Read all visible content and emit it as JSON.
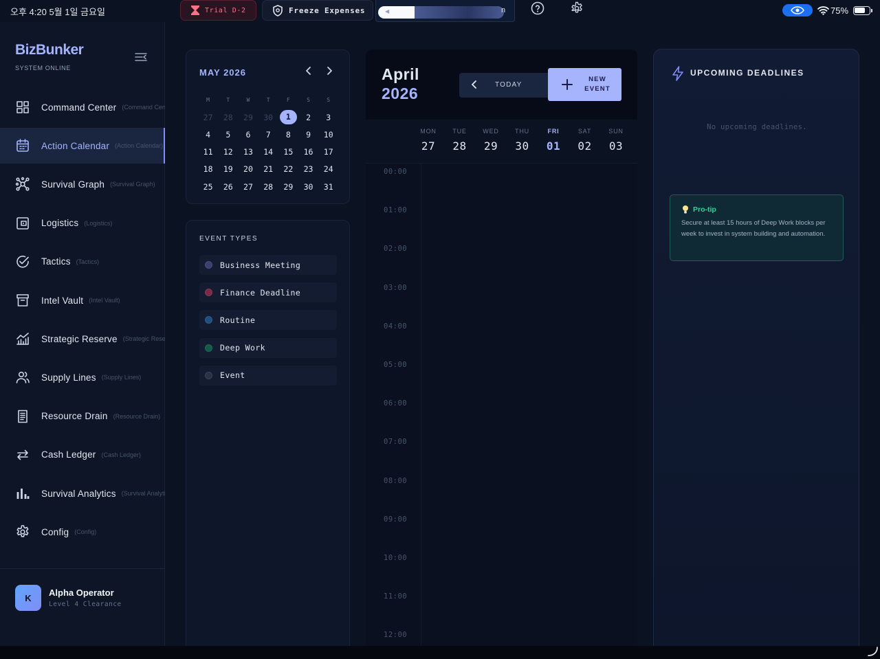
{
  "status_bar": {
    "time": "오후 4:20  5월 1일 금요일",
    "trial_label": "Trial D-2",
    "freeze_label": "Freeze Expenses",
    "url_fragment": "n",
    "battery": "75%"
  },
  "sidebar": {
    "brand": "BizBunker",
    "status": "SYSTEM ONLINE",
    "items": [
      {
        "label": "Command Center",
        "sub": "(Command Center)",
        "icon": "dashboard-icon"
      },
      {
        "label": "Action Calendar",
        "sub": "(Action Calendar)",
        "icon": "calendar-icon",
        "active": true
      },
      {
        "label": "Survival Graph",
        "sub": "(Survival Graph)",
        "icon": "graph-nodes-icon"
      },
      {
        "label": "Logistics",
        "sub": "(Logistics)",
        "icon": "wallet-icon"
      },
      {
        "label": "Tactics",
        "sub": "(Tactics)",
        "icon": "check-circle-icon"
      },
      {
        "label": "Intel Vault",
        "sub": "(Intel Vault)",
        "icon": "archive-icon"
      },
      {
        "label": "Strategic Reserve",
        "sub": "(Strategic Reserve)",
        "icon": "growth-chart-icon"
      },
      {
        "label": "Supply Lines",
        "sub": "(Supply Lines)",
        "icon": "users-icon"
      },
      {
        "label": "Resource Drain",
        "sub": "(Resource Drain)",
        "icon": "receipt-icon"
      },
      {
        "label": "Cash Ledger",
        "sub": "(Cash Ledger)",
        "icon": "transfer-arrows-icon"
      },
      {
        "label": "Survival Analytics",
        "sub": "(Survival Analytics)",
        "icon": "bar-chart-icon"
      },
      {
        "label": "Config",
        "sub": "(Config)",
        "icon": "gear-icon"
      }
    ],
    "user": {
      "initial": "K",
      "name": "Alpha Operator",
      "level": "Level 4 Clearance"
    }
  },
  "mini_calendar": {
    "month": "MAY 2026",
    "weekday_heads": [
      "M",
      "T",
      "W",
      "T",
      "F",
      "S",
      "S"
    ],
    "weeks": [
      [
        "27",
        "28",
        "29",
        "30",
        "1",
        "2",
        "3"
      ],
      [
        "4",
        "5",
        "6",
        "7",
        "8",
        "9",
        "10"
      ],
      [
        "11",
        "12",
        "13",
        "14",
        "15",
        "16",
        "17"
      ],
      [
        "18",
        "19",
        "20",
        "21",
        "22",
        "23",
        "24"
      ],
      [
        "25",
        "26",
        "27",
        "28",
        "29",
        "30",
        "31"
      ]
    ],
    "selected": "1"
  },
  "event_types": {
    "title": "EVENT TYPES",
    "items": [
      {
        "label": "Business Meeting",
        "color": "#3b3f70"
      },
      {
        "label": "Finance Deadline",
        "color": "#7a2a45"
      },
      {
        "label": "Routine",
        "color": "#1f4f80"
      },
      {
        "label": "Deep Work",
        "color": "#125a4a"
      },
      {
        "label": "Event",
        "color": "#2a3244"
      }
    ]
  },
  "main_calendar": {
    "month": "April",
    "year": "2026",
    "today_label": "TODAY",
    "new_event_label": "NEW EVENT",
    "days": [
      {
        "name": "MON",
        "num": "27"
      },
      {
        "name": "TUE",
        "num": "28"
      },
      {
        "name": "WED",
        "num": "29"
      },
      {
        "name": "THU",
        "num": "30"
      },
      {
        "name": "FRI",
        "num": "01",
        "today": true
      },
      {
        "name": "SAT",
        "num": "02"
      },
      {
        "name": "SUN",
        "num": "03"
      }
    ],
    "hours": [
      "00:00",
      "01:00",
      "02:00",
      "03:00",
      "04:00",
      "05:00",
      "06:00",
      "07:00",
      "08:00",
      "09:00",
      "10:00",
      "11:00",
      "12:00"
    ]
  },
  "deadlines": {
    "title": "UPCOMING DEADLINES",
    "empty": "No upcoming deadlines.",
    "tip_title": "Pro-tip",
    "tip_text": "Secure at least 15 hours of Deep Work blocks per week to invest in system building and automation."
  }
}
